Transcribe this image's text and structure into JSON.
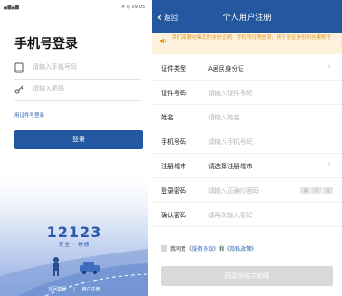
{
  "left": {
    "status_signal": "▄▆▄▆",
    "status_right": "✳ ◎ 09:05",
    "title": "手机号登录",
    "phone_placeholder": "请输入手机号码",
    "password_placeholder": "请输入密码",
    "cert_login_link": "用证件号登录",
    "login_button": "登录",
    "app_number": "12123",
    "slogan": "安全 · 畅通",
    "forgot_password": "找回密码",
    "separator": "|",
    "register": "用户注册"
  },
  "right": {
    "back_label": "返回",
    "title": "个人用户注册",
    "notice": "我们需要收集您的身份证明、手机号码等信息，用于验证身份和创建账号",
    "form": [
      {
        "label": "证件类型",
        "value": "A居民身份证",
        "placeholder": ""
      },
      {
        "label": "证件号码",
        "value": "",
        "placeholder": "请输入证件号码"
      },
      {
        "label": "姓名",
        "value": "",
        "placeholder": "请输入姓名"
      },
      {
        "label": "手机号码",
        "value": "",
        "placeholder": "请输入手机号码"
      },
      {
        "label": "注册城市",
        "value": "请选择注册城市",
        "placeholder": ""
      },
      {
        "label": "登录密码",
        "value": "",
        "placeholder": "请输入正确的密码"
      },
      {
        "label": "确认密码",
        "value": "",
        "placeholder": "请再次输入密码"
      }
    ],
    "password_strength": [
      "弱",
      "中",
      "强"
    ],
    "agree_prefix": "我同意",
    "service_agreement": "《服务协议》",
    "agree_and": "和",
    "privacy_policy": "《隐私政策》",
    "agree_button": "同意协议并继续"
  },
  "colors": {
    "brand_blue": "#23579f",
    "notice_bg": "#fff2dd",
    "notice_text": "#e49a2a",
    "link_blue": "#2d5fb0",
    "disabled_button": "#d9d9d9"
  }
}
